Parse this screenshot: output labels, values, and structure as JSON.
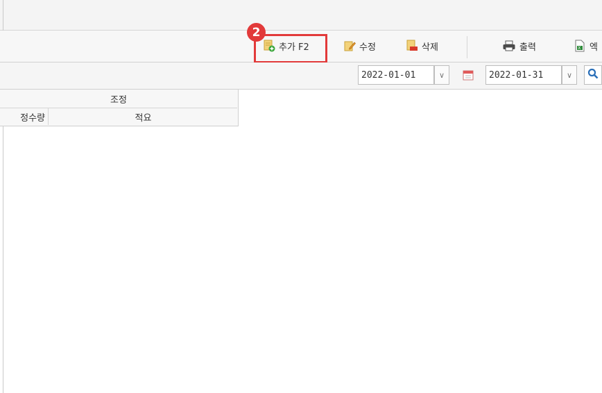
{
  "toolbar": {
    "badge_number": "2",
    "add_label": "추가 F2",
    "edit_label": "수정",
    "delete_label": "삭제",
    "print_label": "출력",
    "excel_label": "엑"
  },
  "filter": {
    "date_from": "2022-01-01",
    "date_to": "2022-01-31",
    "dropdown_glyph": "∨"
  },
  "grid": {
    "group_header": "조정",
    "columns": [
      "정수량",
      "적요"
    ]
  },
  "colors": {
    "highlight": "#e23a3a",
    "search_icon": "#2a6fb8"
  }
}
